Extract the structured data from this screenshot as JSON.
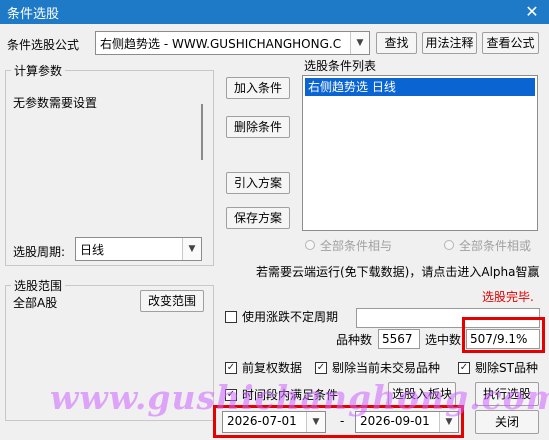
{
  "window": {
    "title": "条件选股",
    "close_glyph": "✕"
  },
  "formula": {
    "label": "条件选股公式",
    "selected": "右侧趋势选  -  WWW.GUSHICHANGHONG.C",
    "buttons": {
      "find": "查找",
      "usage": "用法注释",
      "view": "查看公式"
    }
  },
  "params": {
    "title": "计算参数",
    "message": "无参数需要设置"
  },
  "period": {
    "label": "选股周期:",
    "value": "日线"
  },
  "conditions": {
    "list_title": "选股条件列表",
    "items": [
      "右侧趋势选  日线"
    ],
    "add": "加入条件",
    "delete": "删除条件",
    "import": "引入方案",
    "save": "保存方案",
    "and_label": "全部条件相与",
    "or_label": "全部条件相或"
  },
  "cloud_notice": "若需要云端运行(免下载数据)，请点击进入Alpha智赢",
  "status": "选股完毕.",
  "range": {
    "title": "选股范围",
    "value": "全部A股",
    "change": "改变范围"
  },
  "options": {
    "zhangdie": "使用涨跌不定周期",
    "fuquan": "前复权数据",
    "exclude_untraded": "剔除当前未交易品种",
    "exclude_st": "剔除ST品种",
    "time_range": "时间段内满足条件"
  },
  "stats": {
    "count_label": "品种数",
    "count_value": "5567",
    "selected_label": "选中数",
    "selected_value": "507/9.1%"
  },
  "dates": {
    "start": "2026-07-01",
    "separator": "-",
    "end": "2026-09-01"
  },
  "actions": {
    "to_block": "选股入板块",
    "execute": "执行选股",
    "close": "关闭"
  },
  "watermark": "www.gushichanghong.com",
  "colors": {
    "titlebar": "#1e7ac6",
    "highlight": "#0a64d2",
    "alert_red": "#e60000",
    "status_red": "#e00000"
  },
  "icons": {
    "combo_arrow": "▼",
    "check": "✓"
  }
}
